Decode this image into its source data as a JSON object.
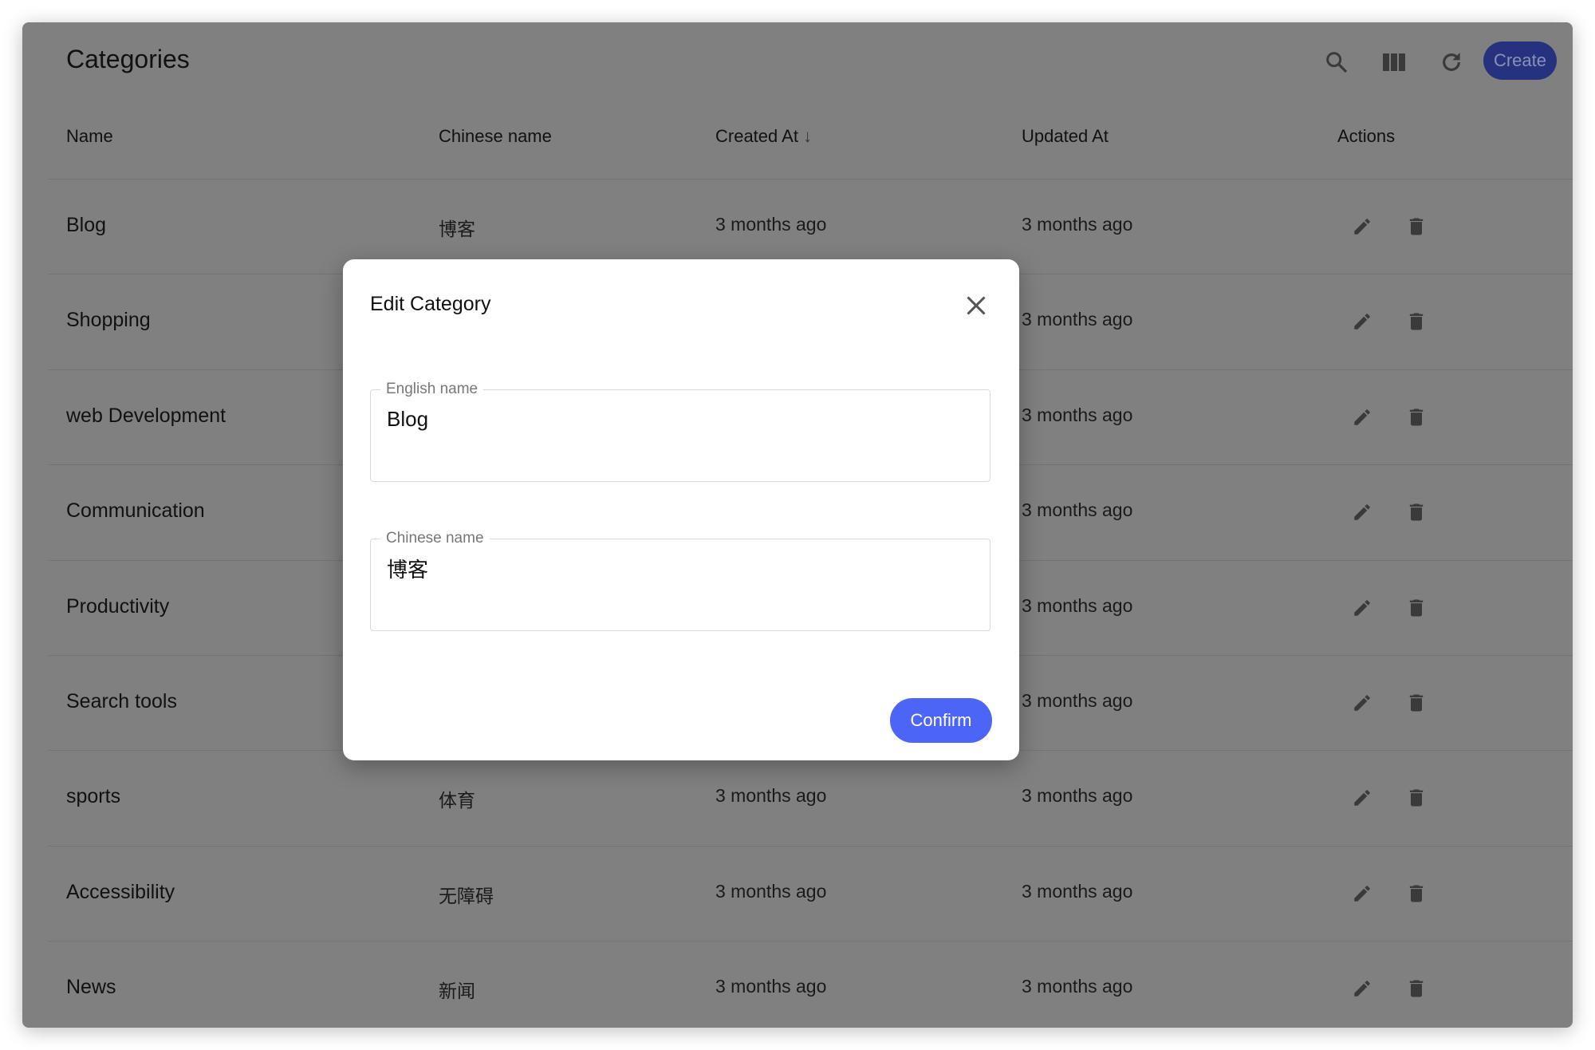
{
  "header": {
    "title": "Categories",
    "create_label": "Create",
    "icons": [
      "search-icon",
      "columns-icon",
      "refresh-icon"
    ]
  },
  "columns": {
    "name": "Name",
    "chinese": "Chinese name",
    "created": "Created At",
    "updated": "Updated At",
    "actions": "Actions",
    "sort_indicator": "↓"
  },
  "rows": [
    {
      "name": "Blog",
      "chinese": "博客",
      "created": "3 months ago",
      "updated": "3 months ago"
    },
    {
      "name": "Shopping",
      "chinese": "",
      "created": "",
      "updated": "3 months ago"
    },
    {
      "name": "web Development",
      "chinese": "",
      "created": "",
      "updated": "3 months ago"
    },
    {
      "name": "Communication",
      "chinese": "",
      "created": "",
      "updated": "3 months ago"
    },
    {
      "name": "Productivity",
      "chinese": "",
      "created": "",
      "updated": "3 months ago"
    },
    {
      "name": "Search tools",
      "chinese": "",
      "created": "",
      "updated": "3 months ago"
    },
    {
      "name": "sports",
      "chinese": "体育",
      "created": "3 months ago",
      "updated": "3 months ago"
    },
    {
      "name": "Accessibility",
      "chinese": "无障碍",
      "created": "3 months ago",
      "updated": "3 months ago"
    },
    {
      "name": "News",
      "chinese": "新闻",
      "created": "3 months ago",
      "updated": "3 months ago"
    }
  ],
  "modal": {
    "title": "Edit Category",
    "english_label": "English name",
    "english_value": "Blog",
    "chinese_label": "Chinese name",
    "chinese_value": "博客",
    "confirm_label": "Confirm"
  },
  "colors": {
    "primary": "#4c65f6",
    "overlay": "#808080"
  }
}
